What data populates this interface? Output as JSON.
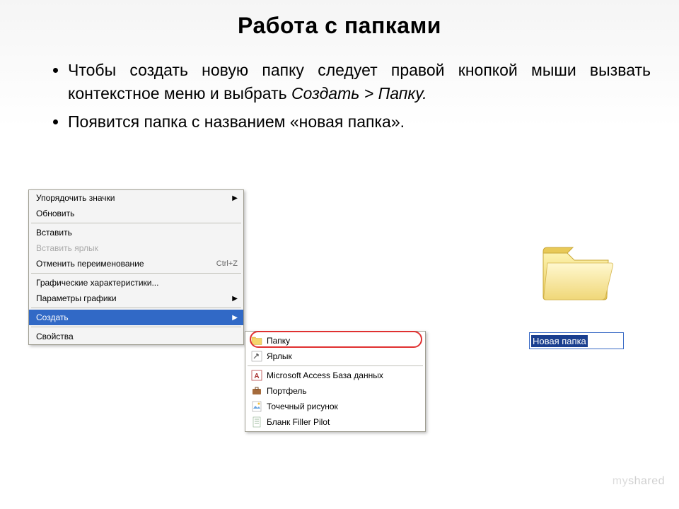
{
  "title": "Работа с папками",
  "bullets": {
    "b1a": "Чтобы создать новую папку следует правой кнопкой мыши вызвать контекстное меню и выбрать ",
    "b1_italic": "Создать > Папку.",
    "b2": "Появится папка с названием «новая папка»."
  },
  "contextMenu": {
    "arrangeIcons": "Упорядочить значки",
    "refresh": "Обновить",
    "paste": "Вставить",
    "pasteShortcut": "Вставить ярлык",
    "undoRename": "Отменить переименование",
    "undoShortcut": "Ctrl+Z",
    "graphicsChar": "Графические характеристики...",
    "graphicsParams": "Параметры графики",
    "create": "Создать",
    "properties": "Свойства"
  },
  "subMenu": {
    "folder": "Папку",
    "shortcut": "Ярлык",
    "access": "Microsoft Access База данных",
    "briefcase": "Портфель",
    "bitmap": "Точечный рисунок",
    "fillerPilot": "Бланк Filler Pilot"
  },
  "newFolder": {
    "label": "Новая папка"
  },
  "watermark": "myshared"
}
